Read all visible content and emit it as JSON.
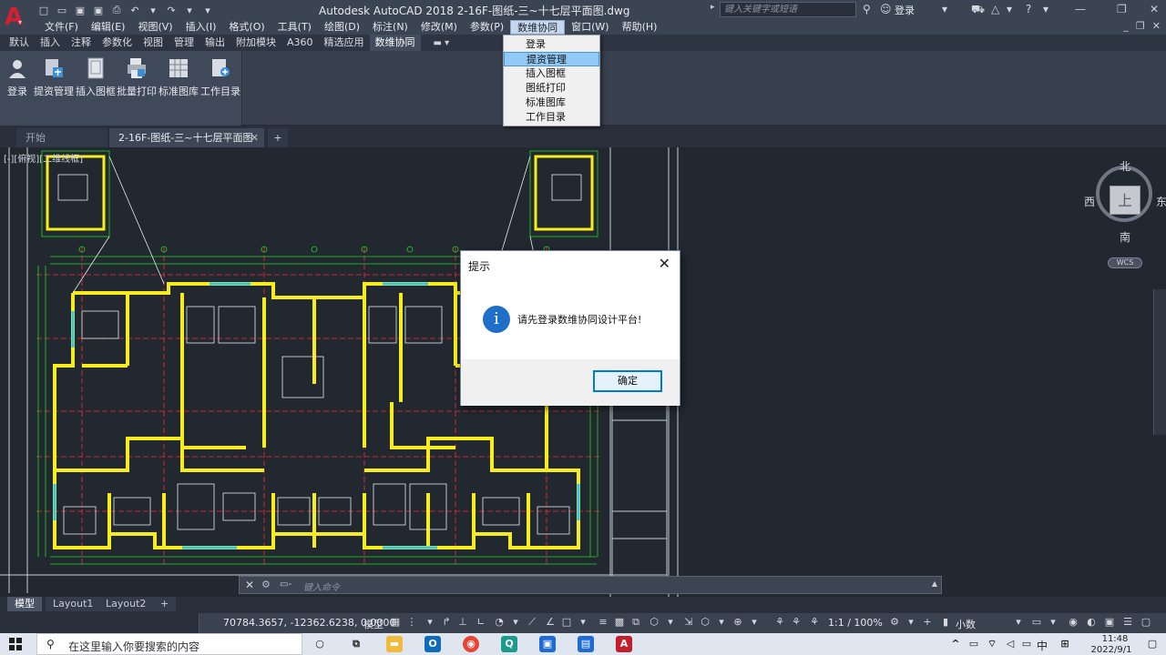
{
  "window": {
    "title": "Autodesk AutoCAD 2018    2-16F-图纸-三~十七层平面图.dwg",
    "search_placeholder": "键入关键字或短语",
    "login_label": "登录"
  },
  "menubar": {
    "items": [
      "文件(F)",
      "编辑(E)",
      "视图(V)",
      "插入(I)",
      "格式(O)",
      "工具(T)",
      "绘图(D)",
      "标注(N)",
      "修改(M)",
      "参数(P)",
      "数维协同",
      "窗口(W)",
      "帮助(H)"
    ],
    "active": "数维协同"
  },
  "ribbon": {
    "tabs": [
      "默认",
      "插入",
      "注释",
      "参数化",
      "视图",
      "管理",
      "输出",
      "附加模块",
      "A360",
      "精选应用",
      "数维协同"
    ],
    "active_tab": "数维协同",
    "buttons": [
      {
        "label": "登录",
        "icon": "user-icon"
      },
      {
        "label": "提资管理",
        "icon": "data-management-icon"
      },
      {
        "label": "插入图框",
        "icon": "insert-frame-icon"
      },
      {
        "label": "批量打印",
        "icon": "batch-print-icon"
      },
      {
        "label": "标准图库",
        "icon": "standard-library-icon"
      },
      {
        "label": "工作目录",
        "icon": "work-directory-icon"
      }
    ]
  },
  "dropdown": {
    "items": [
      "登录",
      "提资管理",
      "插入图框",
      "图纸打印",
      "标准图库",
      "工作目录"
    ],
    "highlighted": "提资管理"
  },
  "doc_tabs": {
    "start": "开始",
    "current": "2-16F-图纸-三~十七层平面图",
    "add": "+"
  },
  "viewport": {
    "label": "[-][俯视][二维线框]"
  },
  "viewcube": {
    "north": "北",
    "south": "南",
    "east": "东",
    "west": "西",
    "face": "上",
    "wcs": "WCS"
  },
  "dialog": {
    "title": "提示",
    "message": "请先登录数维协同设计平台!",
    "ok_label": "确定",
    "icon": "info-icon"
  },
  "command_line": {
    "prompt": "▭-",
    "placeholder": "键入命令"
  },
  "layout_tabs": {
    "items": [
      "模型",
      "Layout1",
      "Layout2"
    ],
    "active": "模型"
  },
  "status_bar": {
    "coordinates": "70784.3657, -12362.6238, 0.0000",
    "mode": "模型",
    "scale": "1:1 / 100%",
    "units": "小数"
  },
  "taskbar": {
    "search_placeholder": "在这里输入你要搜索的内容",
    "ime": "中",
    "time": "11:48",
    "date": "2022/9/1"
  },
  "colors": {
    "wall": "#f7ec1d",
    "grid_line": "#1fd81f",
    "axis": "#ff2a2a",
    "window": "#33c6e6",
    "accent": "#0078d7"
  }
}
